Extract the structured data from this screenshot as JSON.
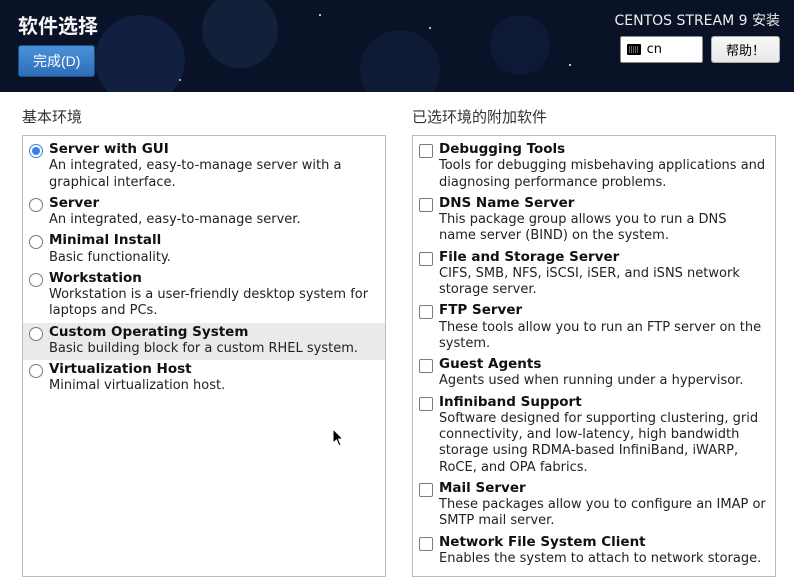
{
  "header": {
    "title": "软件选择",
    "done": "完成(D)",
    "install_label": "CENTOS STREAM 9 安装",
    "lang": "cn",
    "help": "帮助！"
  },
  "left": {
    "title": "基本环境",
    "items": [
      {
        "label": "Server with GUI",
        "desc": "An integrated, easy-to-manage server with a graphical interface.",
        "selected": true
      },
      {
        "label": "Server",
        "desc": "An integrated, easy-to-manage server.",
        "selected": false
      },
      {
        "label": "Minimal Install",
        "desc": "Basic functionality.",
        "selected": false
      },
      {
        "label": "Workstation",
        "desc": "Workstation is a user-friendly desktop system for laptops and PCs.",
        "selected": false
      },
      {
        "label": "Custom Operating System",
        "desc": "Basic building block for a custom RHEL system.",
        "selected": false,
        "hover": true
      },
      {
        "label": "Virtualization Host",
        "desc": "Minimal virtualization host.",
        "selected": false
      }
    ]
  },
  "right": {
    "title": "已选环境的附加软件",
    "items": [
      {
        "label": "Debugging Tools",
        "desc": "Tools for debugging misbehaving applications and diagnosing performance problems."
      },
      {
        "label": "DNS Name Server",
        "desc": "This package group allows you to run a DNS name server (BIND) on the system."
      },
      {
        "label": "File and Storage Server",
        "desc": "CIFS, SMB, NFS, iSCSI, iSER, and iSNS network storage server."
      },
      {
        "label": "FTP Server",
        "desc": "These tools allow you to run an FTP server on the system."
      },
      {
        "label": "Guest Agents",
        "desc": "Agents used when running under a hypervisor."
      },
      {
        "label": "Infiniband Support",
        "desc": "Software designed for supporting clustering, grid connectivity, and low-latency, high bandwidth storage using RDMA-based InfiniBand, iWARP, RoCE, and OPA fabrics."
      },
      {
        "label": "Mail Server",
        "desc": "These packages allow you to configure an IMAP or SMTP mail server."
      },
      {
        "label": "Network File System Client",
        "desc": "Enables the system to attach to network storage."
      }
    ]
  }
}
